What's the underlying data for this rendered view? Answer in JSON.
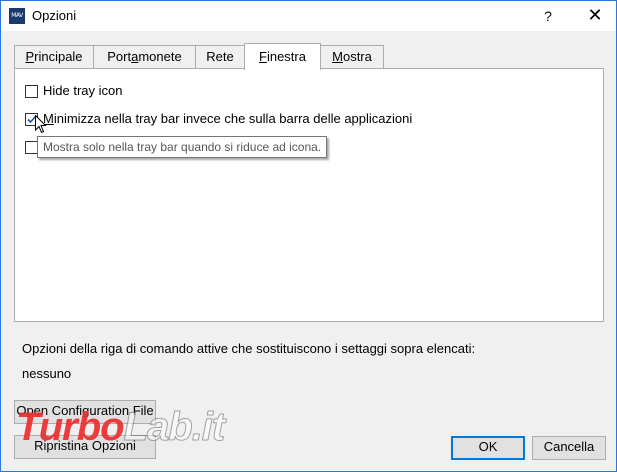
{
  "window": {
    "title": "Opzioni",
    "icon_text": "MAV",
    "help_label": "?",
    "close_label": "✕"
  },
  "tabs": [
    {
      "label": "Principale",
      "mnemonic": "P",
      "rest": "rincipale"
    },
    {
      "label": "Portamonete",
      "mnemonic": "a",
      "pre": "Port",
      "rest": "monete"
    },
    {
      "label": "Rete"
    },
    {
      "label": "Finestra",
      "mnemonic": "F",
      "rest": "inestra",
      "active": true
    },
    {
      "label": "Mostra",
      "mnemonic": "M",
      "rest": "ostra"
    }
  ],
  "options": [
    {
      "label": "Hide tray icon",
      "checked": false
    },
    {
      "label": "Minimizza nella tray bar invece che sulla barra delle applicazioni",
      "mnemonic": "M",
      "rest": "inimizza nella tray bar invece che sulla barra delle applicazioni",
      "checked": true
    },
    {
      "label": "",
      "checked": false
    }
  ],
  "tooltip": "Mostra solo nella tray bar quando si riduce ad icona.",
  "cmdline_info": "Opzioni della riga di comando attive che sostituiscono i settaggi sopra elencati:",
  "cmdline_value": "nessuno",
  "buttons": {
    "open_config": "Open Configuration File",
    "reset": "Ripristina Opzioni",
    "ok": "OK",
    "cancel": "Cancella"
  },
  "watermark": {
    "part1": "Turbo",
    "part2": "Lab.it"
  },
  "colors": {
    "accent": "#0078d7",
    "window_border": "#2b79d6"
  }
}
